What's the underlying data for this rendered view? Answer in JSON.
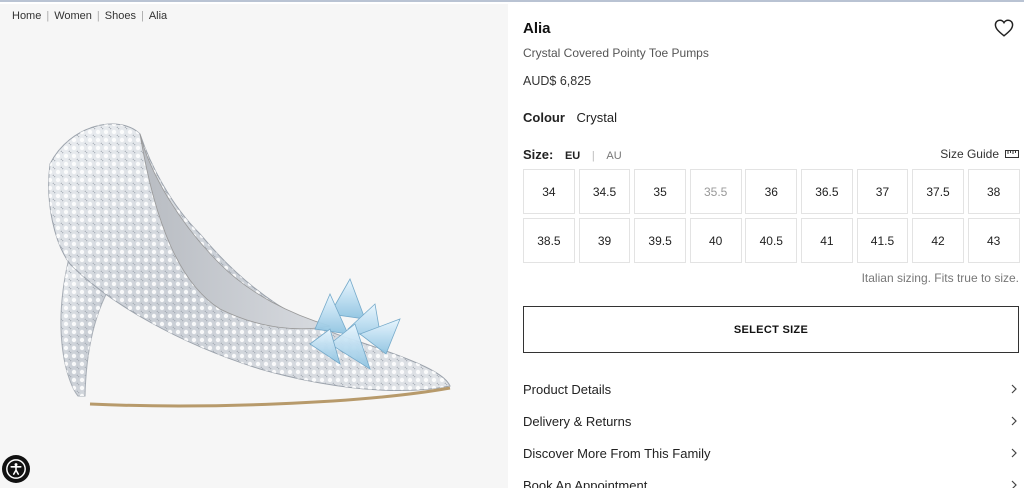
{
  "breadcrumb": [
    "Home",
    "Women",
    "Shoes",
    "Alia"
  ],
  "product": {
    "title": "Alia",
    "subtitle": "Crystal Covered Pointy Toe Pumps",
    "price": "AUD$ 6,825",
    "colour_label": "Colour",
    "colour_value": "Crystal"
  },
  "size_selector": {
    "label": "Size:",
    "eu": "EU",
    "separator": "|",
    "au": "AU",
    "guide": "Size Guide",
    "sizes": [
      {
        "v": "34"
      },
      {
        "v": "34.5"
      },
      {
        "v": "35"
      },
      {
        "v": "35.5",
        "disabled": true
      },
      {
        "v": "36"
      },
      {
        "v": "36.5"
      },
      {
        "v": "37"
      },
      {
        "v": "37.5"
      },
      {
        "v": "38"
      },
      {
        "v": "38.5"
      },
      {
        "v": "39"
      },
      {
        "v": "39.5"
      },
      {
        "v": "40"
      },
      {
        "v": "40.5"
      },
      {
        "v": "41"
      },
      {
        "v": "41.5"
      },
      {
        "v": "42"
      },
      {
        "v": "43"
      }
    ],
    "note": "Italian sizing. Fits true to size."
  },
  "select_button": "SELECT SIZE",
  "accordion": [
    "Product Details",
    "Delivery & Returns",
    "Discover More From This Family",
    "Book An Appointment"
  ],
  "icons": {
    "wishlist": "heart-icon",
    "size_guide": "ruler-icon",
    "chevron": "chevron-right-icon",
    "accessibility": "accessibility-icon"
  }
}
